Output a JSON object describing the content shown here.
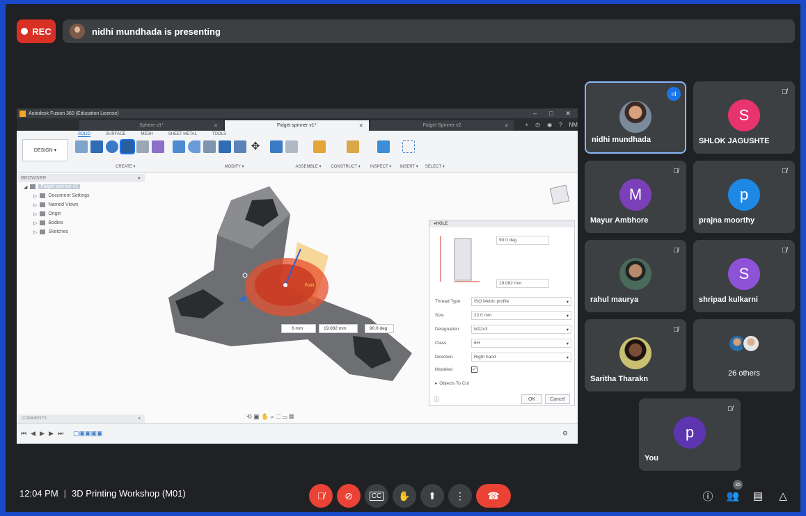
{
  "recording": {
    "label": "REC"
  },
  "presenter_bar": {
    "text": "nidhi mundhada is presenting"
  },
  "fusion": {
    "window_title": "Autodesk Fusion 360 (Education License)",
    "tabs": [
      {
        "label": "Sphere v1*",
        "active": false
      },
      {
        "label": "Fidget spinner v1*",
        "active": true
      },
      {
        "label": "Fidget Spinner v2",
        "active": false
      }
    ],
    "user_initials": "NM",
    "workspace": "DESIGN ▾",
    "ribbon_tabs": [
      "SOLID",
      "SURFACE",
      "MESH",
      "SHEET METAL",
      "TOOLS"
    ],
    "ribbon_groups": [
      "CREATE ▾",
      "MODIFY ▾",
      "ASSEMBLE ▾",
      "CONSTRUCT ▾",
      "INSPECT ▾",
      "INSERT ▾",
      "SELECT ▾"
    ],
    "browser": {
      "title": "BROWSER",
      "root": "Fidget spinner v1",
      "items": [
        "Document Settings",
        "Named Views",
        "Origin",
        "Bodies",
        "Sketches"
      ]
    },
    "viewport": {
      "dims": {
        "depth": "6 mm",
        "diameter": "19.082 mm",
        "angle": "90.0 deg"
      },
      "point_label": "Point"
    },
    "hole": {
      "title": "HOLE",
      "angle": "90.0 deg",
      "diameter": "19.082 mm",
      "fields": [
        {
          "label": "Thread Type",
          "value": "ISO Metric profile"
        },
        {
          "label": "Size",
          "value": "22.0 mm"
        },
        {
          "label": "Designation",
          "value": "M22x3"
        },
        {
          "label": "Class",
          "value": "6H"
        },
        {
          "label": "Direction",
          "value": "Right hand"
        }
      ],
      "modeled_label": "Modeled",
      "objects_to_cut": "Objects To Cut",
      "ok_label": "OK",
      "cancel_label": "Cancel"
    },
    "comments_label": "COMMENTS"
  },
  "participants": [
    {
      "name": "nidhi mundhada",
      "initial": "",
      "color": "",
      "photo": true,
      "speaking": true
    },
    {
      "name": "SHLOK JAGUSHTE",
      "initial": "S",
      "color": "#e8336f"
    },
    {
      "name": "Mayur Ambhore",
      "initial": "M",
      "color": "#7b3fb8"
    },
    {
      "name": "prajna moorthy",
      "initial": "p",
      "color": "#1e88e5"
    },
    {
      "name": "rahul maurya",
      "initial": "",
      "color": "",
      "photo": true
    },
    {
      "name": "shripad kulkarni",
      "initial": "S",
      "color": "#8e52d6"
    },
    {
      "name": "Saritha Tharakn",
      "initial": "",
      "color": "",
      "photo": true
    },
    {
      "name": "26 others",
      "initial": "",
      "color": ""
    },
    {
      "name": "You",
      "initial": "p",
      "color": "#5e35b1"
    }
  ],
  "meeting": {
    "time": "12:04 PM",
    "title": "3D Printing Workshop (M01)",
    "people_count": "35"
  },
  "colors": {
    "red": "#ea4335",
    "tile": "#3c4043",
    "bg": "#202124",
    "accent": "#8ab4f8"
  }
}
